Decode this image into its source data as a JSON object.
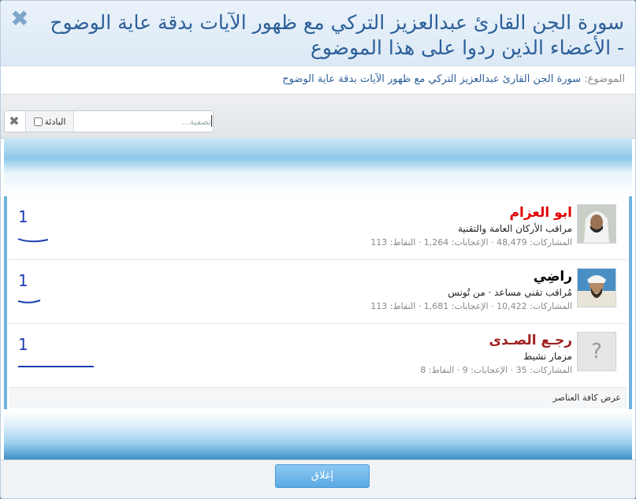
{
  "dialog": {
    "title": "سورة الجن القارئ عبدالعزيز التركي مع ظهور الآيات بدقة عاية الوضوح - الأعضاء الذين ردوا على هذا الموضوع",
    "topic_label": "الموضوع:",
    "topic_link": "سورة الجن القارئ عبدالعزيز التركي مع ظهور الآيات بدقة عاية الوضوح",
    "close_label": "إغلاق",
    "see_all_label": "عرض كافة العناصر"
  },
  "filter": {
    "placeholder": "تصفية...",
    "prefix_label": "البادئة",
    "clear_icon": "close-icon"
  },
  "members": [
    {
      "name": "ابو العزام",
      "name_color": "#e00000",
      "title": "مراقب الأركان العامة والتقنية",
      "stats": "المشاركات: 48,479 · الإعجابات: 1,264 · النقاط: 113",
      "reply_count": "1"
    },
    {
      "name": "راضِي",
      "name_color": "#000000",
      "title": "مُراقب تقني مساعد · من تُونس",
      "stats": "المشاركات: 10,422 · الإعجابات: 1,681 · النقاط: 113",
      "reply_count": "1"
    },
    {
      "name": "رجـع الصـدى",
      "name_color": "#a02020",
      "title": "مزمار نشيط",
      "stats": "المشاركات: 35 · الإعجابات: 9 · النقاط: 8",
      "reply_count": "1",
      "avatar_placeholder": "?"
    }
  ],
  "colors": {
    "accent": "#2b5f99",
    "button": "#5aa9e4",
    "pen_mark": "#1c3fb0"
  }
}
